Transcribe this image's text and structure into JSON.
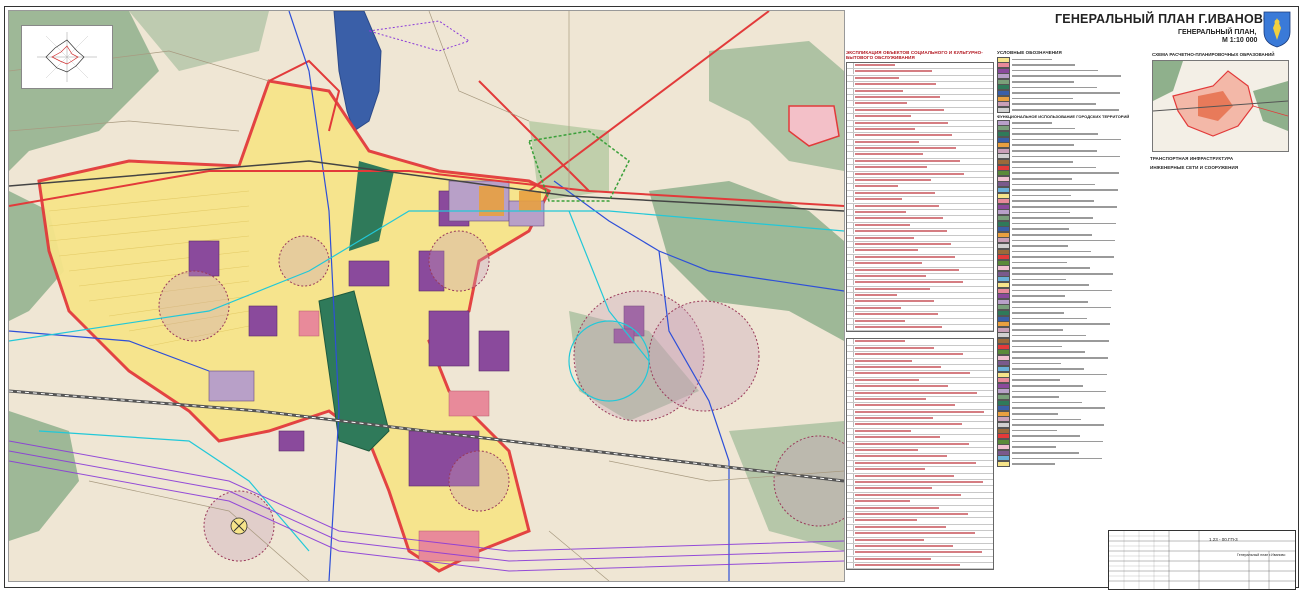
{
  "header": {
    "title": "ГЕНЕРАЛЬНЫЙ ПЛАН Г.ИВАНОВО",
    "subtitle": "ГЕНЕРАЛЬНЫЙ ПЛАН,",
    "scale": "М 1:10 000"
  },
  "legend": {
    "explication_title": "ЭКСПЛИКАЦИЯ ОБЪЕКТОВ СОЦИАЛЬНОГО И КУЛЬТУРНО-БЫТОВОГО ОБСЛУЖИВАНИЯ",
    "conventions_title": "УСЛОВНЫЕ ОБОЗНАЧЕНИЯ",
    "functional_zones_title": "ФУНКЦИОНАЛЬНОЕ ИСПОЛЬЗОВАНИЕ ГОРОДСКИХ ТЕРРИТОРИЙ",
    "transport_title": "ТРАНСПОРТНАЯ ИНФРАСТРУКТУРА",
    "engineering_title": "ИНЖЕНЕРНЫЕ СЕТИ И СООРУЖЕНИЯ"
  },
  "scheme": {
    "title": "СХЕМА РАСЧЕТНО-ПЛАНИРОВОЧНЫХ ОБРАЗОВАНИЙ"
  },
  "stamp": {
    "code": "1.23 - 00.ГП-3",
    "sheet_name": "Генеральный план г.Иваново"
  },
  "colors": {
    "map_background": "#efe6d4",
    "residential": "#f6e48a",
    "public_business": "#8a4a9c",
    "industrial": "#7a5a8c",
    "recreation_green": "#7aa07a",
    "forest": "#8fb08c",
    "water": "#3a5fa8",
    "boundary": "#e23a3a",
    "protection_zone": "#c9a0b8",
    "railway": "#555555"
  },
  "icons": [
    "crest-icon",
    "wind-rose-icon"
  ]
}
